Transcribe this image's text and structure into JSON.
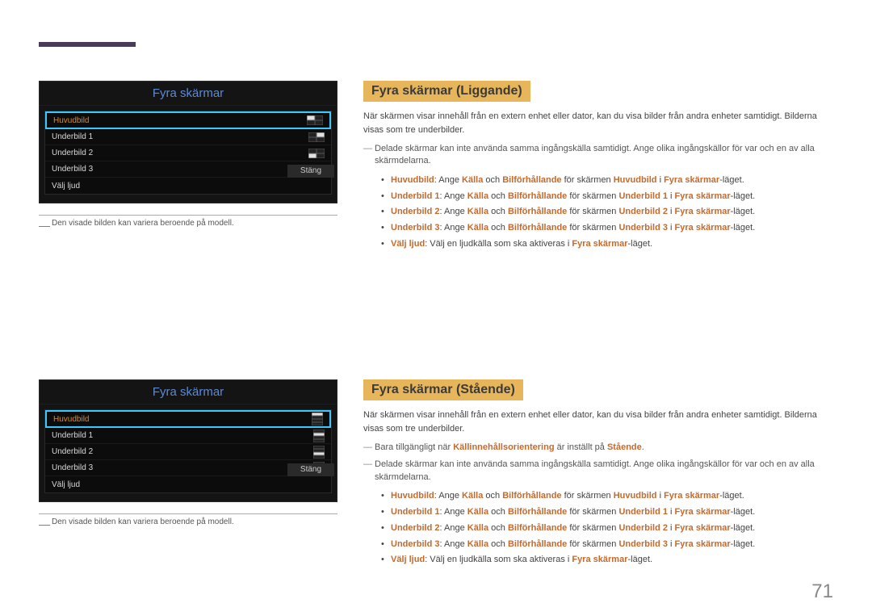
{
  "page_number": "71",
  "osd_title": "Fyra skärmar",
  "osd_items": [
    "Huvudbild",
    "Underbild 1",
    "Underbild 2",
    "Underbild 3",
    "Välj ljud"
  ],
  "osd_close": "Stäng",
  "footnote": "Den visade bilden kan variera beroende på modell.",
  "sec1": {
    "heading": "Fyra skärmar (Liggande)",
    "intro": "När skärmen visar innehåll från en extern enhet eller dator, kan du visa bilder från andra enheter samtidigt. Bilderna visas som tre underbilder.",
    "note1": "Delade skärmar kan inte använda samma ingångskälla samtidigt. Ange olika ingångskällor för var och en av alla skärmdelarna."
  },
  "sec2": {
    "heading": "Fyra skärmar (Stående)",
    "intro": "När skärmen visar innehåll från en extern enhet eller dator, kan du visa bilder från andra enheter samtidigt. Bilderna visas som tre underbilder.",
    "note0_pre": "Bara tillgängligt när ",
    "note0_hl": "Källinnehållsorientering",
    "note0_mid": " är inställt på ",
    "note0_hl2": "Stående",
    "note1": "Delade skärmar kan inte använda samma ingångskälla samtidigt. Ange olika ingångskällor för var och en av alla skärmdelarna."
  },
  "bullets_common": {
    "b1_a": "Huvudbild",
    "b1_b": ": Ange ",
    "b1_c": "Källa",
    "b1_d": " och ",
    "b1_e": "Bilförhållande",
    "b1_f": " för skärmen ",
    "b1_g": "Huvudbild",
    "b1_h": " i ",
    "b1_i": "Fyra skärmar",
    "b1_j": "-läget.",
    "b2_a": "Underbild 1",
    "b2_g": "Underbild 1",
    "b3_a": "Underbild 2",
    "b3_g": "Underbild 2",
    "b4_a": "Underbild 3",
    "b4_g": "Underbild 3",
    "b5_a": "Välj ljud",
    "b5_b": ": Välj en ljudkälla som ska aktiveras i ",
    "b5_c": "Fyra skärmar",
    "b5_d": "-läget."
  }
}
